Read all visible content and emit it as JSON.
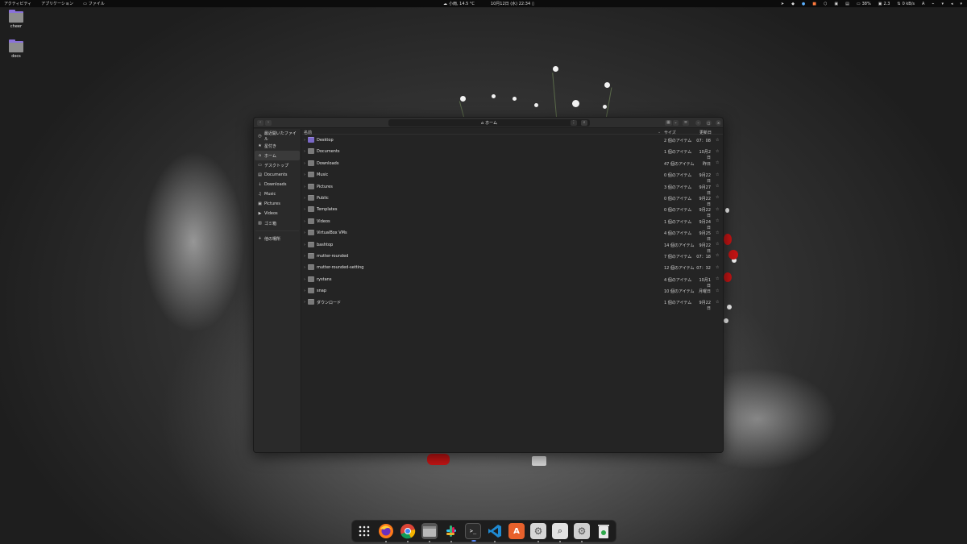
{
  "topbar": {
    "activities": "アクティビティ",
    "applications": "アプリケーション",
    "files_app": "ファイル",
    "weather": "小雨, 14.5 °C",
    "clock": "10月12日 (水)  22:34",
    "battery": "38%",
    "cpu": "2.3",
    "net": "0 kB/s",
    "lang": "A"
  },
  "desktop_icons": [
    {
      "label": "cheer"
    },
    {
      "label": "docs"
    }
  ],
  "window": {
    "title": "ホーム",
    "sidebar": [
      {
        "label": "最近開いたファイル",
        "icon": "clock-icon"
      },
      {
        "label": "星付き",
        "icon": "star-icon"
      },
      {
        "label": "ホーム",
        "icon": "home-icon"
      },
      {
        "label": "デスクトップ",
        "icon": "desktop-icon"
      },
      {
        "label": "Documents",
        "icon": "document-icon"
      },
      {
        "label": "Downloads",
        "icon": "download-icon"
      },
      {
        "label": "Music",
        "icon": "music-icon"
      },
      {
        "label": "Pictures",
        "icon": "picture-icon"
      },
      {
        "label": "Videos",
        "icon": "video-icon"
      },
      {
        "label": "ゴミ箱",
        "icon": "trash-icon"
      },
      {
        "label": "他の場所",
        "icon": "plus-icon"
      }
    ],
    "columns": {
      "name": "名前",
      "size": "サイズ",
      "modified": "更新日"
    },
    "files": [
      {
        "name": "Desktop",
        "size": "2 個のアイテム",
        "modified": "07：08"
      },
      {
        "name": "Documents",
        "size": "1 個のアイテム",
        "modified": "10月2日"
      },
      {
        "name": "Downloads",
        "size": "47 個のアイテム",
        "modified": "昨日"
      },
      {
        "name": "Music",
        "size": "0 個のアイテム",
        "modified": "9月22日"
      },
      {
        "name": "Pictures",
        "size": "3 個のアイテム",
        "modified": "9月27日"
      },
      {
        "name": "Public",
        "size": "0 個のアイテム",
        "modified": "9月22日"
      },
      {
        "name": "Templates",
        "size": "0 個のアイテム",
        "modified": "9月22日"
      },
      {
        "name": "Videos",
        "size": "1 個のアイテム",
        "modified": "9月24日"
      },
      {
        "name": "VirtualBox VMs",
        "size": "4 個のアイテム",
        "modified": "9月25日"
      },
      {
        "name": "bashtop",
        "size": "14 個のアイテム",
        "modified": "9月22日"
      },
      {
        "name": "mutter-rounded",
        "size": "7 個のアイテム",
        "modified": "07：18"
      },
      {
        "name": "mutter-rounded-setting",
        "size": "12 個のアイテム",
        "modified": "07：32"
      },
      {
        "name": "rystans",
        "size": "4 個のアイテム",
        "modified": "10月1日"
      },
      {
        "name": "snap",
        "size": "10 個のアイテム",
        "modified": "月曜日"
      },
      {
        "name": "ダウンロード",
        "size": "1 個のアイテム",
        "modified": "9月22日"
      }
    ]
  },
  "dock": [
    {
      "name": "app-grid-icon"
    },
    {
      "name": "firefox-icon"
    },
    {
      "name": "chrome-icon"
    },
    {
      "name": "files-icon"
    },
    {
      "name": "slack-icon"
    },
    {
      "name": "terminal-icon"
    },
    {
      "name": "vscode-icon"
    },
    {
      "name": "software-center-icon"
    },
    {
      "name": "settings-icon"
    },
    {
      "name": "image-viewer-icon"
    },
    {
      "name": "settings-alt-icon"
    },
    {
      "name": "trash-dock-icon"
    }
  ]
}
